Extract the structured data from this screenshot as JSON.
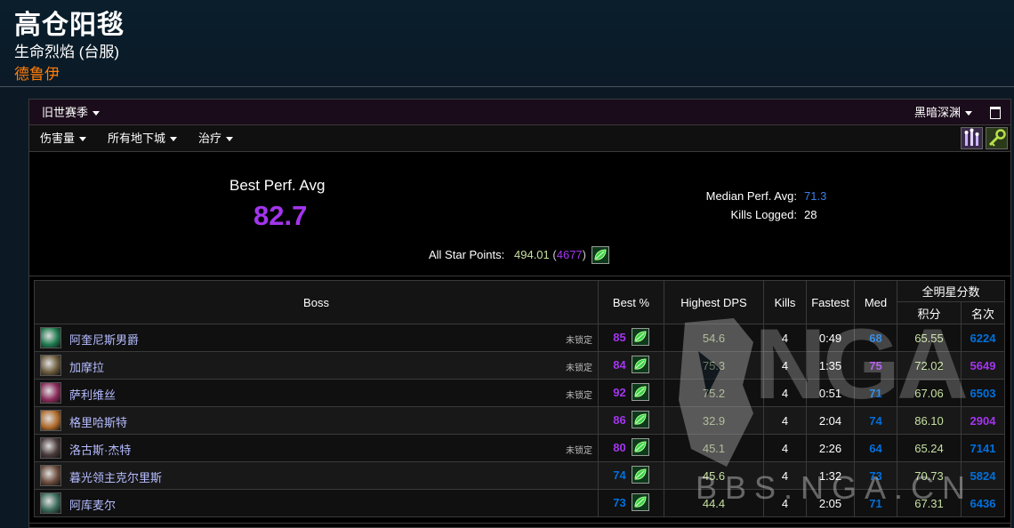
{
  "character": {
    "name": "高仓阳毯",
    "realm": "生命烈焰 (台服)",
    "class": "德鲁伊"
  },
  "colors": {
    "epic": "#a335ee",
    "rare": "#0070dd",
    "legendary": "#ff8000",
    "class_druid": "#ff7d0a",
    "link": "#3b7de8"
  },
  "filters": {
    "season": "旧世赛季",
    "zone": "黑暗深渊",
    "metric": "伤害量",
    "difficulty": "所有地下城",
    "role": "治疗"
  },
  "summary": {
    "best_perf_label": "Best Perf. Avg",
    "best_perf_value": "82.7",
    "median_label": "Median Perf. Avg:",
    "median_value": "71.3",
    "kills_label": "Kills Logged:",
    "kills_value": "28",
    "star_label": "All Star Points:",
    "star_points": "494.01",
    "star_rank_open": "(",
    "star_rank": "4677",
    "star_rank_close": ")"
  },
  "table": {
    "headers": {
      "boss": "Boss",
      "best": "Best %",
      "dps": "Highest DPS",
      "kills": "Kills",
      "fastest": "Fastest",
      "med": "Med",
      "allstar": "全明星分数",
      "points": "积分",
      "rank": "名次"
    },
    "unlocked_label": "未锁定",
    "rows": [
      {
        "boss": "阿奎尼斯男爵",
        "unlocked": true,
        "best": "85",
        "best_tier": "epic",
        "dps": "54.6",
        "kills": "4",
        "fastest": "0:49",
        "med": "68",
        "med_tier": "rare",
        "points": "65.55",
        "rank": "6224",
        "rank_tier": "rare",
        "avatar": "#1e7a4e"
      },
      {
        "boss": "加摩拉",
        "unlocked": true,
        "best": "84",
        "best_tier": "epic",
        "dps": "75.3",
        "kills": "4",
        "fastest": "1:35",
        "med": "75",
        "med_tier": "epic",
        "points": "72.02",
        "rank": "5649",
        "rank_tier": "epic",
        "avatar": "#6b5a3a"
      },
      {
        "boss": "萨利维丝",
        "unlocked": true,
        "best": "92",
        "best_tier": "epic",
        "dps": "75.2",
        "kills": "4",
        "fastest": "0:51",
        "med": "71",
        "med_tier": "rare",
        "points": "67.06",
        "rank": "6503",
        "rank_tier": "rare",
        "avatar": "#8a2a5a"
      },
      {
        "boss": "格里哈斯特",
        "unlocked": false,
        "best": "86",
        "best_tier": "epic",
        "dps": "32.9",
        "kills": "4",
        "fastest": "2:04",
        "med": "74",
        "med_tier": "rare",
        "points": "86.10",
        "rank": "2904",
        "rank_tier": "epic",
        "avatar": "#b06a2a"
      },
      {
        "boss": "洛古斯·杰特",
        "unlocked": true,
        "best": "80",
        "best_tier": "epic",
        "dps": "45.1",
        "kills": "4",
        "fastest": "2:26",
        "med": "64",
        "med_tier": "rare",
        "points": "65.24",
        "rank": "7141",
        "rank_tier": "rare",
        "avatar": "#4a3a3a"
      },
      {
        "boss": "暮光领主克尔里斯",
        "unlocked": false,
        "best": "74",
        "best_tier": "rare",
        "dps": "45.6",
        "kills": "4",
        "fastest": "1:32",
        "med": "73",
        "med_tier": "rare",
        "points": "70.73",
        "rank": "5824",
        "rank_tier": "rare",
        "avatar": "#6a4a3a"
      },
      {
        "boss": "阿库麦尔",
        "unlocked": false,
        "best": "73",
        "best_tier": "rare",
        "dps": "44.4",
        "kills": "4",
        "fastest": "2:05",
        "med": "71",
        "med_tier": "rare",
        "points": "67.31",
        "rank": "6436",
        "rank_tier": "rare",
        "avatar": "#3a6a5a"
      }
    ]
  },
  "watermark": {
    "letters": "NGA",
    "site": "BBS.NGA.CN"
  }
}
